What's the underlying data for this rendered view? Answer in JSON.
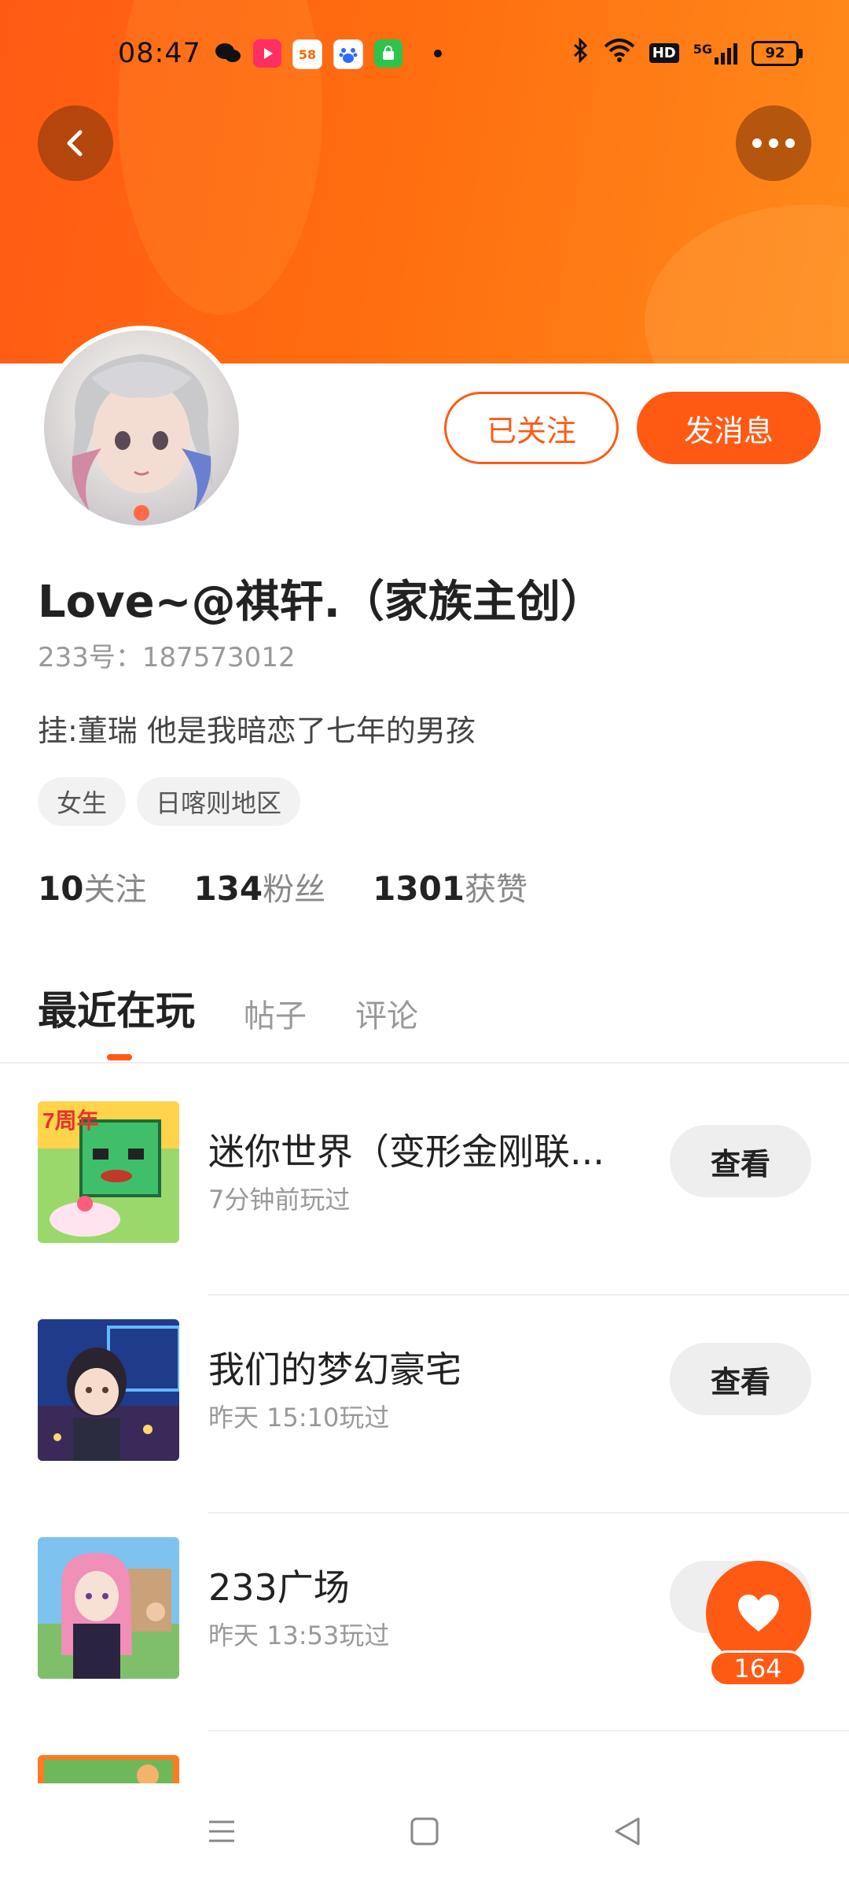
{
  "status_bar": {
    "time": "08:47",
    "app_icons": [
      "wechat-icon",
      "video-app-icon",
      "58-app-icon",
      "baidu-icon",
      "store-app-icon"
    ],
    "bluetooth": "bluetooth-icon",
    "wifi": "wifi-icon",
    "hd": "HD",
    "network": "5G",
    "battery": "92"
  },
  "colors": {
    "accent": "#ff5a14",
    "header_gradient_end": "#ff8a1a"
  },
  "profile": {
    "follow_button": "已关注",
    "message_button": "发消息",
    "name": "Love~@祺轩.（家族主创）",
    "uid": "233号：187573012",
    "bio": "挂:董瑞  他是我暗恋了七年的男孩",
    "tags": [
      "女生",
      "日喀则地区"
    ]
  },
  "stats": [
    {
      "num": "10",
      "label": "关注"
    },
    {
      "num": "134",
      "label": "粉丝"
    },
    {
      "num": "1301",
      "label": "获赞"
    }
  ],
  "tabs": [
    "最近在玩",
    "帖子",
    "评论"
  ],
  "games": [
    {
      "title": "迷你世界（变形金刚联...",
      "subtitle": "7分钟前玩过",
      "action": "查看"
    },
    {
      "title": "我们的梦幻豪宅",
      "subtitle": "昨天 15:10玩过",
      "action": "查看"
    },
    {
      "title": "233广场",
      "subtitle": "昨天 13:53玩过",
      "action": ""
    }
  ],
  "like_fab": {
    "count": "164"
  }
}
